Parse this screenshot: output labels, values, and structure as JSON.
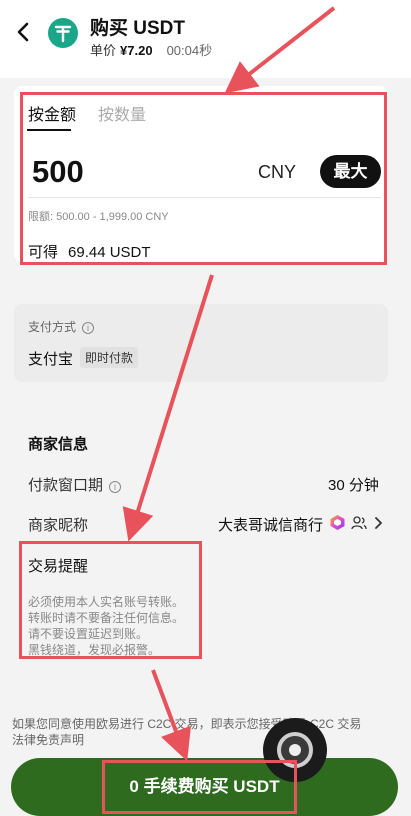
{
  "header": {
    "title": "购买 USDT",
    "price_label": "单价",
    "price_value": "¥7.20",
    "timer": "00:04秒",
    "logo_glyph": "₸"
  },
  "amount_card": {
    "tab_amount": "按金额",
    "tab_quantity": "按数量",
    "amount": "500",
    "currency": "CNY",
    "max_button": "最大",
    "limit_text": "限额: 500.00 - 1,999.00 CNY",
    "receive_label": "可得",
    "receive_value": "69.44 USDT"
  },
  "payment": {
    "label": "支付方式",
    "method": "支付宝",
    "tag": "即时付款"
  },
  "merchant": {
    "title": "商家信息",
    "pay_window_label": "付款窗口期",
    "pay_window_value": "30 分钟",
    "nickname_label": "商家昵称",
    "nickname_value": "大表哥诚信商行"
  },
  "reminder": {
    "title": "交易提醒",
    "lines": [
      "必须使用本人实名账号转账。",
      "转账时请不要备注任何信息。",
      "请不要设置延迟到账。",
      "黑钱绕道，发现必报警。"
    ]
  },
  "disclaimer": {
    "line1": "如果您同意使用欧易进行 C2C 交易，即表示您接受欧易 C2C 交易",
    "line2": "法律免责声明"
  },
  "buy_button": "0 手续费购买 USDT",
  "colors": {
    "annotation": "#e8535b",
    "buy_button": "#2f6b1f",
    "logo": "#1aa688"
  }
}
